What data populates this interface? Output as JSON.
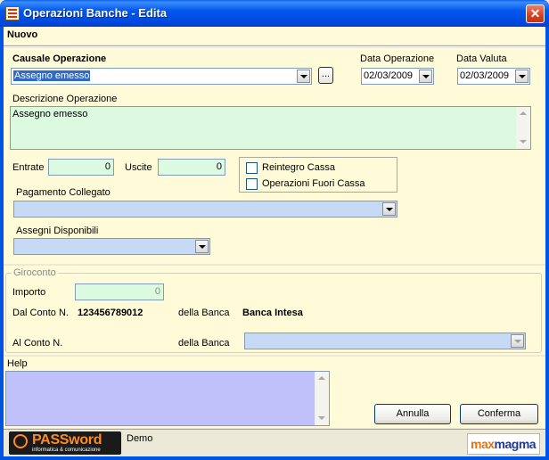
{
  "window": {
    "title": "Operazioni Banche - Edita",
    "close_symbol": "✕"
  },
  "header": {
    "mode_label": "Nuovo"
  },
  "form": {
    "causale_label": "Causale Operazione",
    "causale_value": "Assegno emesso",
    "browse_button": "...",
    "data_operazione_label": "Data Operazione",
    "data_operazione_value": "02/03/2009",
    "data_valuta_label": "Data Valuta",
    "data_valuta_value": "02/03/2009",
    "descrizione_label": "Descrizione Operazione",
    "descrizione_value": "Assegno emesso",
    "entrate_label": "Entrate",
    "entrate_value": "0",
    "uscite_label": "Uscite",
    "uscite_value": "0",
    "reintegro_label": "Reintegro Cassa",
    "reintegro_checked": false,
    "fuori_cassa_label": "Operazioni Fuori Cassa",
    "fuori_cassa_checked": false,
    "pagamento_label": "Pagamento Collegato",
    "pagamento_value": "",
    "assegni_label": "Assegni Disponibili",
    "assegni_value": ""
  },
  "giroconto": {
    "group_title": "Giroconto",
    "importo_label": "Importo",
    "importo_value": "0",
    "dal_conto_label": "Dal Conto N.",
    "dal_conto_value": "123456789012",
    "della_banca_label": "della Banca",
    "dal_banca_value": "Banca Intesa",
    "al_conto_label": "Al Conto N.",
    "al_della_banca_label": "della Banca",
    "al_banca_value": ""
  },
  "help": {
    "label": "Help",
    "text": ""
  },
  "buttons": {
    "annulla": "Annulla",
    "conferma": "Conferma"
  },
  "footer": {
    "brand_name": "PASSword",
    "brand_tagline": "informatica & comunicazione",
    "status_text": "Demo",
    "maxmagma_part1": "max",
    "maxmagma_part2": "magma"
  },
  "colors": {
    "title_bar": "#0054e3",
    "panel_bg": "#fffbd8",
    "input_green": "#dcfae0",
    "combo_blue": "#c6d9f5",
    "help_purple": "#c0c0fa",
    "accent_orange": "#ff8a1f"
  }
}
